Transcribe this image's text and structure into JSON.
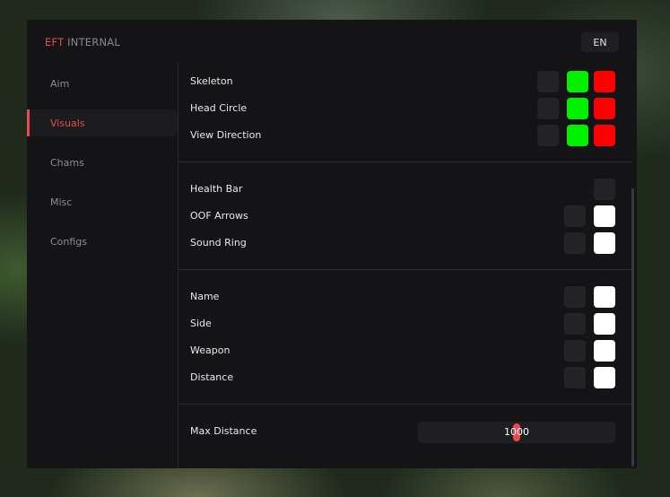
{
  "header": {
    "brand_accent": "EFT",
    "brand_rest": "INTERNAL",
    "language": "EN"
  },
  "sidebar": {
    "items": [
      {
        "label": "Aim",
        "active": false
      },
      {
        "label": "Visuals",
        "active": true
      },
      {
        "label": "Chams",
        "active": false
      },
      {
        "label": "Misc",
        "active": false
      },
      {
        "label": "Configs",
        "active": false
      }
    ]
  },
  "colors": {
    "accent": "#e84a4f",
    "visible_color": "#00f000",
    "invisible_color": "#ff0000",
    "white": "#ffffff",
    "inactive_box": "#232326"
  },
  "visuals": {
    "group1": [
      {
        "label": "Skeleton",
        "enabled": false,
        "color1": "green",
        "color2": "red"
      },
      {
        "label": "Head Circle",
        "enabled": false,
        "color1": "green",
        "color2": "red"
      },
      {
        "label": "View Direction",
        "enabled": false,
        "color1": "green",
        "color2": "red"
      }
    ],
    "group2": [
      {
        "label": "Health Bar",
        "enabled": false
      },
      {
        "label": "OOF Arrows",
        "enabled": false,
        "color": "white"
      },
      {
        "label": "Sound Ring",
        "enabled": false,
        "color": "white"
      }
    ],
    "group3": [
      {
        "label": "Name",
        "enabled": false,
        "color": "white"
      },
      {
        "label": "Side",
        "enabled": false,
        "color": "white"
      },
      {
        "label": "Weapon",
        "enabled": false,
        "color": "white"
      },
      {
        "label": "Distance",
        "enabled": false,
        "color": "white"
      }
    ],
    "max_distance": {
      "label": "Max Distance",
      "value": "1000",
      "fraction": 0.5
    }
  }
}
